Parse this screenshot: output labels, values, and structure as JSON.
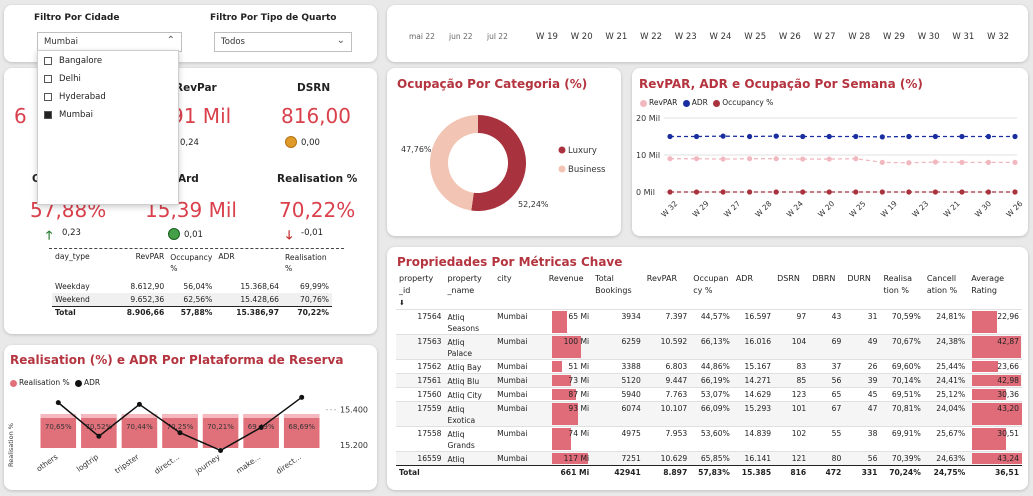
{
  "filters": {
    "city_label": "Filtro Por Cidade",
    "city_value": "Mumbai",
    "city_options": [
      {
        "label": "Bangalore",
        "checked": false
      },
      {
        "label": "Delhi",
        "checked": false
      },
      {
        "label": "Hyderabad",
        "checked": false
      },
      {
        "label": "Mumbai",
        "checked": true
      }
    ],
    "room_label": "Filtro Por Tipo de Quarto",
    "room_value": "Todos"
  },
  "weeks": {
    "months": [
      "mai 22",
      "jun 22",
      "jul 22"
    ],
    "items": [
      "W 19",
      "W 20",
      "W 21",
      "W 22",
      "W 23",
      "W 24",
      "W 25",
      "W 26",
      "W 27",
      "W 28",
      "W 29",
      "W 30",
      "W 31",
      "W 32"
    ]
  },
  "kpis": {
    "revenue_value_partial": "6",
    "revpar_label": "RevPar",
    "revpar_value_partial": "91 Mil",
    "revpar_delta": "0,24",
    "dsrn_label": "DSRN",
    "dsrn_value": "816,00",
    "dsrn_delta": "0,00",
    "occupancy_label_partial": "O",
    "occupancy_value": "57,88%",
    "occupancy_delta": "0,23",
    "adr_label_partial": "Ard",
    "adr_value": "15,39 Mil",
    "adr_delta": "0,01",
    "realisation_label": "Realisation %",
    "realisation_value": "70,22%",
    "realisation_delta": "-0,01",
    "colors": {
      "up": "#2e7d32",
      "down": "#c62828",
      "neutral_green": "#43a047",
      "neutral_orange": "#e09a2a"
    }
  },
  "daytype_table": {
    "headers": [
      "day_type",
      "RevPAR",
      "Occupancy %",
      "ADR",
      "Realisation %"
    ],
    "rows": [
      [
        "Weekday",
        "8.612,90",
        "56,04%",
        "15.368,64",
        "69,99%"
      ],
      [
        "Weekend",
        "9.652,36",
        "62,56%",
        "15.428,66",
        "70,76%"
      ]
    ],
    "total": [
      "Total",
      "8.906,66",
      "57,88%",
      "15.386,97",
      "70,22%"
    ]
  },
  "realisation_chart": {
    "title": "Realisation (%) e ADR Por Plataforma de Reserva",
    "legend": [
      "Realisation %",
      "ADR"
    ],
    "ylabel": "Realisation %",
    "right_ticks": [
      "15.400",
      "15.200"
    ]
  },
  "occupancy_chart": {
    "title": "Ocupação Por Categoria (%)",
    "legend": [
      "Luxury",
      "Business"
    ],
    "labels": [
      "47,76%",
      "52,24%"
    ]
  },
  "weekly_chart": {
    "title": "RevPAR, ADR e Ocupação Por Semana (%)",
    "legend": [
      "RevPAR",
      "ADR",
      "Occupancy %"
    ],
    "y_ticks": [
      "20 Mil",
      "10 Mil",
      "0 Mil"
    ]
  },
  "chart_data": [
    {
      "type": "bar",
      "title": "Realisation (%) e ADR Por Plataforma de Reserva",
      "categories": [
        "others",
        "logtrip",
        "tripster",
        "direct...",
        "journey",
        "make...",
        "direct..."
      ],
      "series": [
        {
          "name": "Realisation %",
          "values": [
            70.65,
            70.52,
            70.44,
            70.25,
            70.21,
            69.49,
            68.69
          ],
          "labels": [
            "70,65%",
            "70,52%",
            "70,44%",
            "70,25%",
            "70,21%",
            "69,49%",
            "68,69%"
          ]
        },
        {
          "name": "ADR",
          "values": [
            15440,
            15250,
            15430,
            15270,
            15170,
            15300,
            15470
          ]
        }
      ],
      "ylim_right": [
        15150,
        15500
      ],
      "colors": {
        "bar": "#e0717b",
        "line": "#111111"
      }
    },
    {
      "type": "pie",
      "title": "Ocupação Por Categoria (%)",
      "categories": [
        "Luxury",
        "Business"
      ],
      "values": [
        52.24,
        47.76
      ],
      "colors": [
        "#a8323d",
        "#f2c4b3"
      ]
    },
    {
      "type": "line",
      "title": "RevPAR, ADR e Ocupação Por Semana (%)",
      "categories": [
        "W 32",
        "W 29",
        "W 27",
        "W 28",
        "W 24",
        "W 20",
        "W 25",
        "W 19",
        "W 23",
        "W 21",
        "W 30",
        "W 26"
      ],
      "series": [
        {
          "name": "RevPAR",
          "values": [
            9000,
            9000,
            8900,
            9000,
            9000,
            8900,
            8900,
            9000,
            8000,
            7900,
            8100,
            8000,
            8000,
            8000
          ]
        },
        {
          "name": "ADR",
          "values": [
            15000,
            15000,
            15100,
            15000,
            15100,
            15000,
            15000,
            15000,
            14900,
            15000,
            15000,
            15000,
            15000,
            15000
          ]
        },
        {
          "name": "Occupancy %",
          "values": [
            0,
            0,
            0,
            0,
            0,
            0,
            0,
            0,
            0,
            0,
            0,
            0,
            0,
            0
          ]
        }
      ],
      "ylim": [
        0,
        20000
      ],
      "colors": [
        "#f2b8c0",
        "#1a2ea0",
        "#a8323d"
      ]
    }
  ],
  "properties_table": {
    "title": "Propriedades Por Métricas Chave",
    "headers": [
      "property_id",
      "property_name",
      "city",
      "Revenue",
      "Total Bookings",
      "RevPAR",
      "Occupancy %",
      "ADR",
      "DSRN",
      "DBRN",
      "DURN",
      "Realisation %",
      "Cancellation %",
      "Average Rating"
    ],
    "header_lines": [
      [
        "property",
        "_id"
      ],
      [
        "property",
        "_name"
      ],
      [
        "city"
      ],
      [
        "Revenue"
      ],
      [
        "Total",
        "Bookings"
      ],
      [
        "RevPAR"
      ],
      [
        "Occupan",
        "cy %"
      ],
      [
        "ADR"
      ],
      [
        "DSRN"
      ],
      [
        "DBRN"
      ],
      [
        "DURN"
      ],
      [
        "Realisa",
        "tion %"
      ],
      [
        "Cancell",
        "ation %"
      ],
      [
        "Average",
        "Rating"
      ]
    ],
    "rows": [
      {
        "id": "17564",
        "name": "Atliq Seasons",
        "city": "Mumbai",
        "revenue": "65 Mi",
        "rev_frac": 0.55,
        "bookings": "3934",
        "revpar": "7.397",
        "occ": "44,57%",
        "adr": "16.597",
        "dsrn": "97",
        "dbrn": "43",
        "durn": "31",
        "real": "70,59%",
        "canc": "24,81%",
        "rating": "22,96",
        "rating_frac": 0.53
      },
      {
        "id": "17563",
        "name": "Atliq Palace",
        "city": "Mumbai",
        "revenue": "100 Mi",
        "rev_frac": 0.85,
        "bookings": "6259",
        "revpar": "10.592",
        "occ": "66,13%",
        "adr": "16.016",
        "dsrn": "104",
        "dbrn": "69",
        "durn": "49",
        "real": "70,67%",
        "canc": "24,38%",
        "rating": "42,87",
        "rating_frac": 0.99
      },
      {
        "id": "17562",
        "name": "Atliq Bay",
        "city": "Mumbai",
        "revenue": "51 Mi",
        "rev_frac": 0.43,
        "bookings": "3388",
        "revpar": "6.803",
        "occ": "44,86%",
        "adr": "15.167",
        "dsrn": "83",
        "dbrn": "37",
        "durn": "26",
        "real": "69,60%",
        "canc": "25,44%",
        "rating": "23,66",
        "rating_frac": 0.55
      },
      {
        "id": "17561",
        "name": "Atliq Blu",
        "city": "Mumbai",
        "revenue": "73 Mi",
        "rev_frac": 0.62,
        "bookings": "5120",
        "revpar": "9.447",
        "occ": "66,19%",
        "adr": "14.271",
        "dsrn": "85",
        "dbrn": "56",
        "durn": "39",
        "real": "70,14%",
        "canc": "24,41%",
        "rating": "42,98",
        "rating_frac": 0.99
      },
      {
        "id": "17560",
        "name": "Atliq City",
        "city": "Mumbai",
        "revenue": "87 Mi",
        "rev_frac": 0.74,
        "bookings": "5940",
        "revpar": "7.763",
        "occ": "53,07%",
        "adr": "14.629",
        "dsrn": "123",
        "dbrn": "65",
        "durn": "45",
        "real": "69,51%",
        "canc": "25,12%",
        "rating": "30,36",
        "rating_frac": 0.7
      },
      {
        "id": "17559",
        "name": "Atliq Exotica",
        "city": "Mumbai",
        "revenue": "93 Mi",
        "rev_frac": 0.79,
        "bookings": "6074",
        "revpar": "10.107",
        "occ": "66,09%",
        "adr": "15.293",
        "dsrn": "101",
        "dbrn": "67",
        "durn": "47",
        "real": "70,81%",
        "canc": "24,04%",
        "rating": "43,20",
        "rating_frac": 1.0
      },
      {
        "id": "17558",
        "name": "Atliq Grands",
        "city": "Mumbai",
        "revenue": "74 Mi",
        "rev_frac": 0.63,
        "bookings": "4975",
        "revpar": "7.953",
        "occ": "53,60%",
        "adr": "14.839",
        "dsrn": "102",
        "dbrn": "55",
        "durn": "38",
        "real": "69,91%",
        "canc": "25,67%",
        "rating": "30,51",
        "rating_frac": 0.71
      },
      {
        "id": "16559",
        "name": "Atliq",
        "city": "Mumbai",
        "revenue": "117 Mi",
        "rev_frac": 1.0,
        "bookings": "7251",
        "revpar": "10.629",
        "occ": "65,85%",
        "adr": "16.141",
        "dsrn": "121",
        "dbrn": "80",
        "durn": "56",
        "real": "70,39%",
        "canc": "24,63%",
        "rating": "43,24",
        "rating_frac": 1.0
      }
    ],
    "total": [
      "Total",
      "",
      "",
      "661 Mi",
      "42941",
      "8.897",
      "57,83%",
      "15.385",
      "816",
      "472",
      "331",
      "70,24%",
      "24,75%",
      "36,51"
    ]
  }
}
